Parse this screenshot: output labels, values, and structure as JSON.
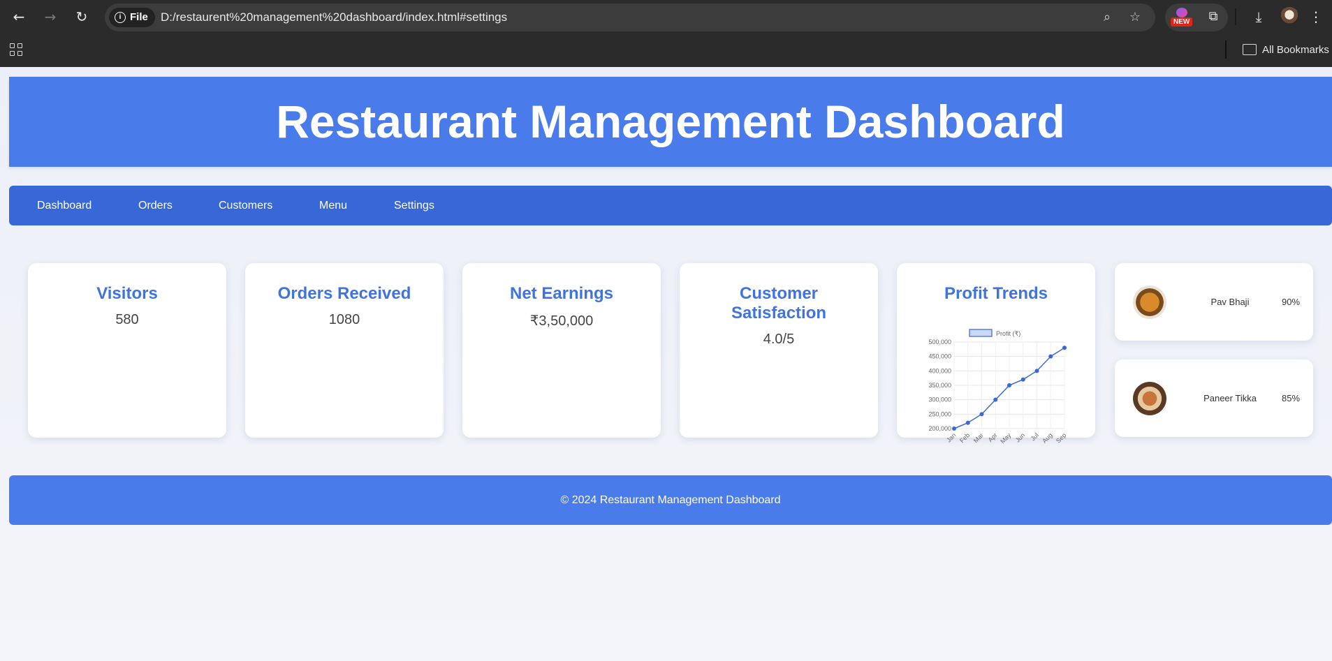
{
  "browser": {
    "file_chip": "File",
    "url": "D:/restaurent%20management%20dashboard/index.html#settings",
    "new_badge": "NEW",
    "bookmarks_label": "All Bookmarks"
  },
  "header": {
    "title": "Restaurant Management Dashboard"
  },
  "nav": {
    "items": [
      "Dashboard",
      "Orders",
      "Customers",
      "Menu",
      "Settings"
    ]
  },
  "cards": [
    {
      "title": "Visitors",
      "value": "580"
    },
    {
      "title": "Orders Received",
      "value": "1080"
    },
    {
      "title": "Net Earnings",
      "value": "₹3,50,000"
    },
    {
      "title": "Customer Satisfaction",
      "value": "4.0/5"
    },
    {
      "title": "Profit Trends"
    }
  ],
  "dishes": [
    {
      "name": "Pav Bhaji",
      "percent": "90%"
    },
    {
      "name": "Paneer Tikka",
      "percent": "85%"
    }
  ],
  "footer": {
    "text": "© 2024 Restaurant Management Dashboard"
  },
  "colors": {
    "accent": "#4a7bea",
    "nav": "#3868d8",
    "title_blue": "#3f74e0",
    "chrome": "#2b2b2b"
  },
  "chart_data": {
    "type": "line",
    "categories": [
      "Jan",
      "Feb",
      "Mar",
      "Apr",
      "May",
      "Jun",
      "Jul",
      "Aug",
      "Sep"
    ],
    "series": [
      {
        "name": "Profit (₹)",
        "values": [
          200000,
          220000,
          250000,
          300000,
          350000,
          370000,
          400000,
          450000,
          480000
        ]
      }
    ],
    "yticks": [
      "500,000",
      "450,000",
      "400,000",
      "350,000",
      "300,000",
      "250,000",
      "200,000"
    ],
    "ylim": [
      200000,
      500000
    ],
    "grid": true,
    "legend": "top"
  }
}
